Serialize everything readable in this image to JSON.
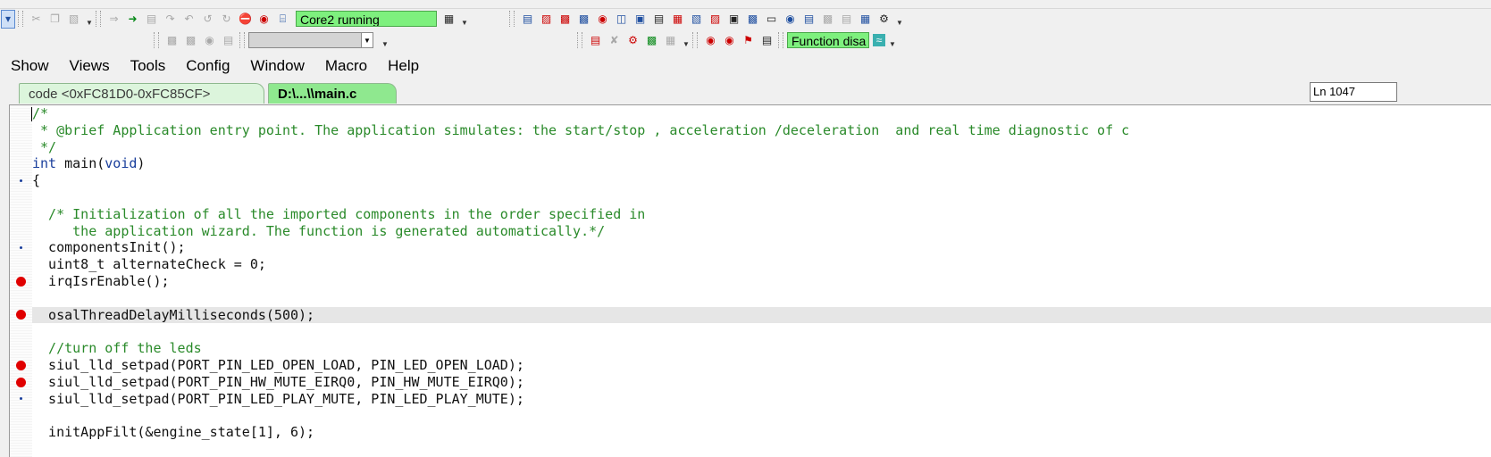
{
  "toolbar": {
    "status_text": "Core2 running",
    "function_text": "Function disa"
  },
  "menu": [
    "Show",
    "Views",
    "Tools",
    "Config",
    "Window",
    "Macro",
    "Help"
  ],
  "tabs": [
    {
      "label": "code <0xFC81D0-0xFC85CF>",
      "active": false
    },
    {
      "label": "D:\\...\\\\main.c",
      "active": true
    }
  ],
  "line_indicator": "Ln 1047",
  "colors": {
    "status_bg": "#7ef07e",
    "active_tab_bg": "#8fe88f",
    "inactive_tab_bg": "#dcf5dc",
    "comment": "#2a8a2a",
    "keyword": "#1a3f9c",
    "breakpoint": "#e00000"
  },
  "code": {
    "lines": [
      {
        "text": "/*",
        "kind": "comment",
        "marker": "none",
        "cursor": true
      },
      {
        "text": " * @brief Application entry point. The application simulates: the start/stop , acceleration /deceleration  and real time diagnostic of c",
        "kind": "comment",
        "marker": "none"
      },
      {
        "text": " */",
        "kind": "comment",
        "marker": "none"
      },
      {
        "text": "int main(void)",
        "kind": "main",
        "marker": "none"
      },
      {
        "text": "{",
        "kind": "text",
        "marker": "dot"
      },
      {
        "text": "",
        "kind": "text",
        "marker": "none"
      },
      {
        "text": "  /* Initialization of all the imported components in the order specified in",
        "kind": "comment",
        "marker": "none"
      },
      {
        "text": "     the application wizard. The function is generated automatically.*/",
        "kind": "comment",
        "marker": "none"
      },
      {
        "text": "  componentsInit();",
        "kind": "text",
        "marker": "dot"
      },
      {
        "text": "  uint8_t alternateCheck = 0;",
        "kind": "text",
        "marker": "none"
      },
      {
        "text": "  irqIsrEnable();",
        "kind": "text",
        "marker": "bp"
      },
      {
        "text": "",
        "kind": "text",
        "marker": "none"
      },
      {
        "text": "  osalThreadDelayMilliseconds(500);",
        "kind": "text",
        "marker": "bp",
        "highlight": true
      },
      {
        "text": "",
        "kind": "text",
        "marker": "none"
      },
      {
        "text": "  //turn off the leds",
        "kind": "comment",
        "marker": "none"
      },
      {
        "text": "  siul_lld_setpad(PORT_PIN_LED_OPEN_LOAD, PIN_LED_OPEN_LOAD);",
        "kind": "text",
        "marker": "bp"
      },
      {
        "text": "  siul_lld_setpad(PORT_PIN_HW_MUTE_EIRQ0, PIN_HW_MUTE_EIRQ0);",
        "kind": "text",
        "marker": "bp"
      },
      {
        "text": "  siul_lld_setpad(PORT_PIN_LED_PLAY_MUTE, PIN_LED_PLAY_MUTE);",
        "kind": "text",
        "marker": "dot"
      },
      {
        "text": "",
        "kind": "text",
        "marker": "none"
      },
      {
        "text": "  initAppFilt(&engine_state[1], 6);",
        "kind": "text",
        "marker": "none"
      }
    ]
  },
  "icons": {
    "toolbar1_left": [
      "cut-icon",
      "copy-icon",
      "paste-icon",
      "step-into-icon",
      "run-to-cursor-icon",
      "step-out-icon",
      "step-over-icon",
      "step-asm-icon",
      "step-back-icon",
      "halt-icon",
      "stop-icon",
      "reset-icon"
    ],
    "toolbar1_right": [
      "source-window-icon",
      "disassembly-icon",
      "memory-icon",
      "register-icon",
      "breakpoint-icon",
      "watch-icon",
      "terminal-icon",
      "trace-icon",
      "profile-icon",
      "peripheral-icon",
      "stack-icon",
      "analysis-icon",
      "display-icon",
      "globe-icon",
      "chart-icon",
      "graph-icon",
      "list-icon",
      "table-icon",
      "settings-icon"
    ],
    "toolbar2_left": [
      "book-icon",
      "bookmark-icon",
      "disk-icon",
      "document-icon"
    ],
    "toolbar2_right": [
      "text-icon",
      "tools-icon",
      "hardware-icon",
      "monitor-icon",
      "grid-icon",
      "bp-set-icon",
      "bp-clear-icon",
      "bp-toggle-icon",
      "bp-list-icon",
      "function-icon"
    ]
  }
}
